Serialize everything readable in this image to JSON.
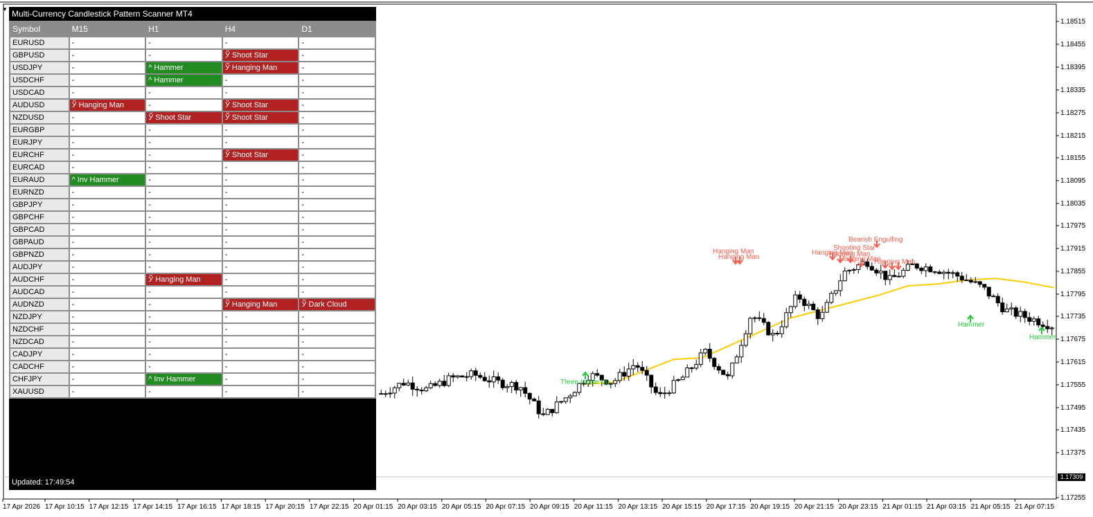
{
  "scanner": {
    "title": "Multi-Currency Candlestick Pattern Scanner MT4",
    "columns": [
      "Symbol",
      "M15",
      "H1",
      "H4",
      "D1"
    ],
    "rows": [
      {
        "symbol": "EURUSD",
        "cells": [
          {
            "text": "-",
            "type": "none"
          },
          {
            "text": "-",
            "type": "none"
          },
          {
            "text": "-",
            "type": "none"
          },
          {
            "text": "-",
            "type": "none"
          }
        ]
      },
      {
        "symbol": "GBPUSD",
        "cells": [
          {
            "text": "-",
            "type": "none"
          },
          {
            "text": "-",
            "type": "none"
          },
          {
            "text": "Ў Shoot Star",
            "type": "bear"
          },
          {
            "text": "-",
            "type": "none"
          }
        ]
      },
      {
        "symbol": "USDJPY",
        "cells": [
          {
            "text": "-",
            "type": "none"
          },
          {
            "text": "^ Hammer",
            "type": "bull"
          },
          {
            "text": "Ў Hanging Man",
            "type": "bear"
          },
          {
            "text": "-",
            "type": "none"
          }
        ]
      },
      {
        "symbol": "USDCHF",
        "cells": [
          {
            "text": "-",
            "type": "none"
          },
          {
            "text": "^ Hammer",
            "type": "bull"
          },
          {
            "text": "-",
            "type": "none"
          },
          {
            "text": "-",
            "type": "none"
          }
        ]
      },
      {
        "symbol": "USDCAD",
        "cells": [
          {
            "text": "-",
            "type": "none"
          },
          {
            "text": "-",
            "type": "none"
          },
          {
            "text": "-",
            "type": "none"
          },
          {
            "text": "-",
            "type": "none"
          }
        ]
      },
      {
        "symbol": "AUDUSD",
        "cells": [
          {
            "text": "Ў Hanging Man",
            "type": "bear"
          },
          {
            "text": "-",
            "type": "none"
          },
          {
            "text": "Ў Shoot Star",
            "type": "bear"
          },
          {
            "text": "-",
            "type": "none"
          }
        ]
      },
      {
        "symbol": "NZDUSD",
        "cells": [
          {
            "text": "-",
            "type": "none"
          },
          {
            "text": "Ў Shoot Star",
            "type": "bear"
          },
          {
            "text": "Ў Shoot Star",
            "type": "bear"
          },
          {
            "text": "-",
            "type": "none"
          }
        ]
      },
      {
        "symbol": "EURGBP",
        "cells": [
          {
            "text": "-",
            "type": "none"
          },
          {
            "text": "-",
            "type": "none"
          },
          {
            "text": "-",
            "type": "none"
          },
          {
            "text": "-",
            "type": "none"
          }
        ]
      },
      {
        "symbol": "EURJPY",
        "cells": [
          {
            "text": "-",
            "type": "none"
          },
          {
            "text": "-",
            "type": "none"
          },
          {
            "text": "-",
            "type": "none"
          },
          {
            "text": "-",
            "type": "none"
          }
        ]
      },
      {
        "symbol": "EURCHF",
        "cells": [
          {
            "text": "-",
            "type": "none"
          },
          {
            "text": "-",
            "type": "none"
          },
          {
            "text": "Ў Shoot Star",
            "type": "bear"
          },
          {
            "text": "-",
            "type": "none"
          }
        ]
      },
      {
        "symbol": "EURCAD",
        "cells": [
          {
            "text": "-",
            "type": "none"
          },
          {
            "text": "-",
            "type": "none"
          },
          {
            "text": "-",
            "type": "none"
          },
          {
            "text": "-",
            "type": "none"
          }
        ]
      },
      {
        "symbol": "EURAUD",
        "cells": [
          {
            "text": "^ Inv Hammer",
            "type": "bull"
          },
          {
            "text": "-",
            "type": "none"
          },
          {
            "text": "-",
            "type": "none"
          },
          {
            "text": "-",
            "type": "none"
          }
        ]
      },
      {
        "symbol": "EURNZD",
        "cells": [
          {
            "text": "-",
            "type": "none"
          },
          {
            "text": "-",
            "type": "none"
          },
          {
            "text": "-",
            "type": "none"
          },
          {
            "text": "-",
            "type": "none"
          }
        ]
      },
      {
        "symbol": "GBPJPY",
        "cells": [
          {
            "text": "-",
            "type": "none"
          },
          {
            "text": "-",
            "type": "none"
          },
          {
            "text": "-",
            "type": "none"
          },
          {
            "text": "-",
            "type": "none"
          }
        ]
      },
      {
        "symbol": "GBPCHF",
        "cells": [
          {
            "text": "-",
            "type": "none"
          },
          {
            "text": "-",
            "type": "none"
          },
          {
            "text": "-",
            "type": "none"
          },
          {
            "text": "-",
            "type": "none"
          }
        ]
      },
      {
        "symbol": "GBPCAD",
        "cells": [
          {
            "text": "-",
            "type": "none"
          },
          {
            "text": "-",
            "type": "none"
          },
          {
            "text": "-",
            "type": "none"
          },
          {
            "text": "-",
            "type": "none"
          }
        ]
      },
      {
        "symbol": "GBPAUD",
        "cells": [
          {
            "text": "-",
            "type": "none"
          },
          {
            "text": "-",
            "type": "none"
          },
          {
            "text": "-",
            "type": "none"
          },
          {
            "text": "-",
            "type": "none"
          }
        ]
      },
      {
        "symbol": "GBPNZD",
        "cells": [
          {
            "text": "-",
            "type": "none"
          },
          {
            "text": "-",
            "type": "none"
          },
          {
            "text": "-",
            "type": "none"
          },
          {
            "text": "-",
            "type": "none"
          }
        ]
      },
      {
        "symbol": "AUDJPY",
        "cells": [
          {
            "text": "-",
            "type": "none"
          },
          {
            "text": "-",
            "type": "none"
          },
          {
            "text": "-",
            "type": "none"
          },
          {
            "text": "-",
            "type": "none"
          }
        ]
      },
      {
        "symbol": "AUDCHF",
        "cells": [
          {
            "text": "-",
            "type": "none"
          },
          {
            "text": "Ў Hanging Man",
            "type": "bear"
          },
          {
            "text": "-",
            "type": "none"
          },
          {
            "text": "-",
            "type": "none"
          }
        ]
      },
      {
        "symbol": "AUDCAD",
        "cells": [
          {
            "text": "-",
            "type": "none"
          },
          {
            "text": "-",
            "type": "none"
          },
          {
            "text": "-",
            "type": "none"
          },
          {
            "text": "-",
            "type": "none"
          }
        ]
      },
      {
        "symbol": "AUDNZD",
        "cells": [
          {
            "text": "-",
            "type": "none"
          },
          {
            "text": "-",
            "type": "none"
          },
          {
            "text": "Ў Hanging Man",
            "type": "bear"
          },
          {
            "text": "Ў Dark Cloud",
            "type": "bear"
          }
        ]
      },
      {
        "symbol": "NZDJPY",
        "cells": [
          {
            "text": "-",
            "type": "none"
          },
          {
            "text": "-",
            "type": "none"
          },
          {
            "text": "-",
            "type": "none"
          },
          {
            "text": "-",
            "type": "none"
          }
        ]
      },
      {
        "symbol": "NZDCHF",
        "cells": [
          {
            "text": "-",
            "type": "none"
          },
          {
            "text": "-",
            "type": "none"
          },
          {
            "text": "-",
            "type": "none"
          },
          {
            "text": "-",
            "type": "none"
          }
        ]
      },
      {
        "symbol": "NZDCAD",
        "cells": [
          {
            "text": "-",
            "type": "none"
          },
          {
            "text": "-",
            "type": "none"
          },
          {
            "text": "-",
            "type": "none"
          },
          {
            "text": "-",
            "type": "none"
          }
        ]
      },
      {
        "symbol": "CADJPY",
        "cells": [
          {
            "text": "-",
            "type": "none"
          },
          {
            "text": "-",
            "type": "none"
          },
          {
            "text": "-",
            "type": "none"
          },
          {
            "text": "-",
            "type": "none"
          }
        ]
      },
      {
        "symbol": "CADCHF",
        "cells": [
          {
            "text": "-",
            "type": "none"
          },
          {
            "text": "-",
            "type": "none"
          },
          {
            "text": "-",
            "type": "none"
          },
          {
            "text": "-",
            "type": "none"
          }
        ]
      },
      {
        "symbol": "CHFJPY",
        "cells": [
          {
            "text": "-",
            "type": "none"
          },
          {
            "text": "^ Inv Hammer",
            "type": "bull"
          },
          {
            "text": "-",
            "type": "none"
          },
          {
            "text": "-",
            "type": "none"
          }
        ]
      },
      {
        "symbol": "XAUUSD",
        "cells": [
          {
            "text": "-",
            "type": "none"
          },
          {
            "text": "-",
            "type": "none"
          },
          {
            "text": "-",
            "type": "none"
          },
          {
            "text": "-",
            "type": "none"
          }
        ]
      }
    ],
    "updated": "Updated: 17:49:54"
  },
  "colors": {
    "bear_cell": "#b22222",
    "bull_cell": "#228b22",
    "bear_label": "#ff5a4a",
    "bull_label": "#22cc33",
    "ma_line": "#ffcc00"
  },
  "price_axis": {
    "labels": [
      "1.18515",
      "1.18455",
      "1.18395",
      "1.18335",
      "1.18275",
      "1.18215",
      "1.18155",
      "1.18095",
      "1.18035",
      "1.17975",
      "1.17915",
      "1.17855",
      "1.17795",
      "1.17735",
      "1.17675",
      "1.17615",
      "1.17555",
      "1.17495",
      "1.17435",
      "1.17375",
      "1.17255"
    ],
    "current_price": "1.17309"
  },
  "time_axis": {
    "labels": [
      "17 Apr 2026",
      "17 Apr 10:15",
      "17 Apr 12:15",
      "17 Apr 14:15",
      "17 Apr 16:15",
      "17 Apr 18:15",
      "17 Apr 20:15",
      "17 Apr 22:15",
      "20 Apr 01:15",
      "20 Apr 03:15",
      "20 Apr 05:15",
      "20 Apr 07:15",
      "20 Apr 09:15",
      "20 Apr 11:15",
      "20 Apr 13:15",
      "20 Apr 15:15",
      "20 Apr 17:15",
      "20 Apr 19:15",
      "20 Apr 21:15",
      "20 Apr 23:15",
      "21 Apr 01:15",
      "21 Apr 03:15",
      "21 Apr 05:15",
      "21 Apr 07:15"
    ]
  },
  "chart_labels": {
    "bearish": [
      "Hanging Man",
      "Hanging Man",
      "Bearish Engulfing",
      "Shooting Star",
      "Hanging Man",
      "Hanging Man",
      "Hanging Man",
      "Hanging Man"
    ],
    "bullish": [
      "Three Inside Up",
      "Hammer",
      "Hammer"
    ]
  },
  "chart_data": {
    "type": "candlestick",
    "series_ma": [
      1.17555,
      1.1756,
      1.1759,
      1.1762,
      1.17625,
      1.1766,
      1.17695,
      1.1773,
      1.1775,
      1.1777,
      1.1779,
      1.17815,
      1.1782,
      1.1783,
      1.17835,
      1.17825,
      1.1781
    ],
    "candles_close_approx": [
      1.1753,
      1.1756,
      1.1754,
      1.1757,
      1.1758,
      1.1756,
      1.1755,
      1.1747,
      1.1752,
      1.1758,
      1.1756,
      1.1761,
      1.1752,
      1.1757,
      1.1764,
      1.1757,
      1.1774,
      1.1768,
      1.1779,
      1.1773,
      1.1785,
      1.1788,
      1.1783,
      1.1787,
      1.1786,
      1.1784,
      1.1781,
      1.1775,
      1.1773,
      1.1771
    ]
  }
}
